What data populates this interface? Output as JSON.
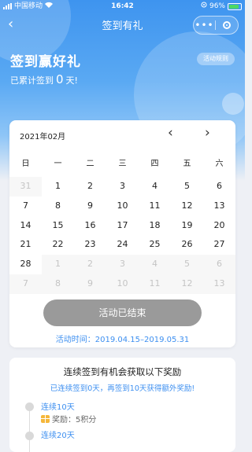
{
  "status_bar": {
    "carrier": "中国移动",
    "time": "16:42",
    "battery": "96%"
  },
  "nav": {
    "title": "签到有礼"
  },
  "hero": {
    "title": "签到赢好礼",
    "rules_label": "活动规则",
    "signed_prefix": "已累计签到",
    "signed_days": "0",
    "signed_suffix": "天!"
  },
  "calendar": {
    "month": "2021年02月",
    "weekdays": [
      "日",
      "一",
      "二",
      "三",
      "四",
      "五",
      "六"
    ],
    "weeks": [
      [
        {
          "d": "31",
          "dim": true
        },
        {
          "d": "1",
          "dim": false
        },
        {
          "d": "2",
          "dim": false
        },
        {
          "d": "3",
          "dim": false
        },
        {
          "d": "4",
          "dim": false
        },
        {
          "d": "5",
          "dim": false
        },
        {
          "d": "6",
          "dim": false
        }
      ],
      [
        {
          "d": "7",
          "dim": false
        },
        {
          "d": "8",
          "dim": false
        },
        {
          "d": "9",
          "dim": false
        },
        {
          "d": "10",
          "dim": false
        },
        {
          "d": "11",
          "dim": false
        },
        {
          "d": "12",
          "dim": false
        },
        {
          "d": "13",
          "dim": false
        }
      ],
      [
        {
          "d": "14",
          "dim": false
        },
        {
          "d": "15",
          "dim": false
        },
        {
          "d": "16",
          "dim": false
        },
        {
          "d": "17",
          "dim": false
        },
        {
          "d": "18",
          "dim": false
        },
        {
          "d": "19",
          "dim": false
        },
        {
          "d": "20",
          "dim": false
        }
      ],
      [
        {
          "d": "21",
          "dim": false
        },
        {
          "d": "22",
          "dim": false
        },
        {
          "d": "23",
          "dim": false
        },
        {
          "d": "24",
          "dim": false
        },
        {
          "d": "25",
          "dim": false
        },
        {
          "d": "26",
          "dim": false
        },
        {
          "d": "27",
          "dim": false
        }
      ],
      [
        {
          "d": "28",
          "dim": false
        },
        {
          "d": "1",
          "dim": true
        },
        {
          "d": "2",
          "dim": true
        },
        {
          "d": "3",
          "dim": true
        },
        {
          "d": "4",
          "dim": true
        },
        {
          "d": "5",
          "dim": true
        },
        {
          "d": "6",
          "dim": true
        }
      ],
      [
        {
          "d": "7",
          "dim": true
        },
        {
          "d": "8",
          "dim": true
        },
        {
          "d": "9",
          "dim": true
        },
        {
          "d": "10",
          "dim": true
        },
        {
          "d": "11",
          "dim": true
        },
        {
          "d": "12",
          "dim": true
        },
        {
          "d": "13",
          "dim": true
        }
      ]
    ],
    "action_label": "活动已结束",
    "period": "活动时间：2019.04.15–2019.05.31"
  },
  "rewards": {
    "title": "连续签到有机会获取以下奖励",
    "subtitle": "已连续签到0天，再签到10天获得额外奖励!",
    "milestones": [
      {
        "title": "连续10天",
        "reward": "奖励：5积分"
      },
      {
        "title": "连续20天"
      }
    ]
  },
  "colors": {
    "accent": "#3d8ff0",
    "header_gradient_top": "#3e94ef",
    "ended_button": "#9a9a9a"
  }
}
